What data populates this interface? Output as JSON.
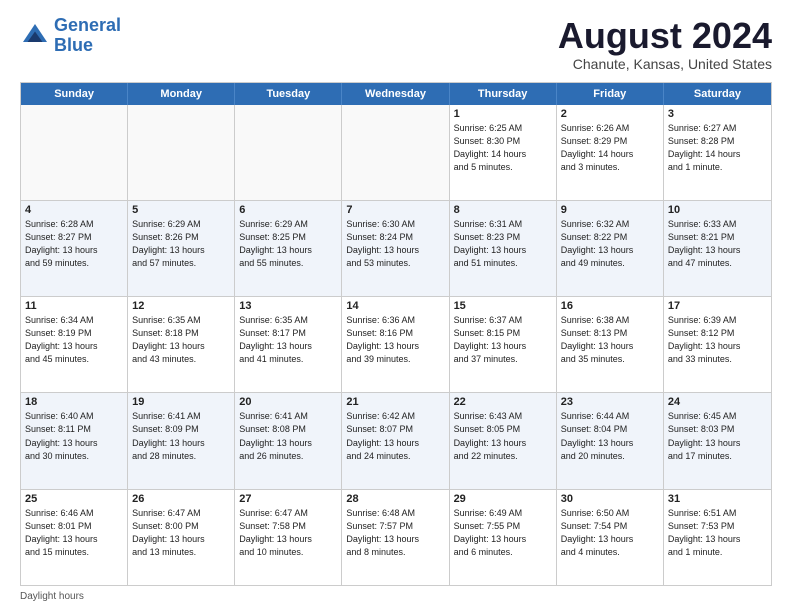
{
  "header": {
    "logo_line1": "General",
    "logo_line2": "Blue",
    "month_title": "August 2024",
    "location": "Chanute, Kansas, United States"
  },
  "weekdays": [
    "Sunday",
    "Monday",
    "Tuesday",
    "Wednesday",
    "Thursday",
    "Friday",
    "Saturday"
  ],
  "footer_note": "Daylight hours",
  "rows": [
    [
      {
        "day": "",
        "info": "",
        "empty": true
      },
      {
        "day": "",
        "info": "",
        "empty": true
      },
      {
        "day": "",
        "info": "",
        "empty": true
      },
      {
        "day": "",
        "info": "",
        "empty": true
      },
      {
        "day": "1",
        "info": "Sunrise: 6:25 AM\nSunset: 8:30 PM\nDaylight: 14 hours\nand 5 minutes.",
        "empty": false
      },
      {
        "day": "2",
        "info": "Sunrise: 6:26 AM\nSunset: 8:29 PM\nDaylight: 14 hours\nand 3 minutes.",
        "empty": false
      },
      {
        "day": "3",
        "info": "Sunrise: 6:27 AM\nSunset: 8:28 PM\nDaylight: 14 hours\nand 1 minute.",
        "empty": false
      }
    ],
    [
      {
        "day": "4",
        "info": "Sunrise: 6:28 AM\nSunset: 8:27 PM\nDaylight: 13 hours\nand 59 minutes.",
        "empty": false
      },
      {
        "day": "5",
        "info": "Sunrise: 6:29 AM\nSunset: 8:26 PM\nDaylight: 13 hours\nand 57 minutes.",
        "empty": false
      },
      {
        "day": "6",
        "info": "Sunrise: 6:29 AM\nSunset: 8:25 PM\nDaylight: 13 hours\nand 55 minutes.",
        "empty": false
      },
      {
        "day": "7",
        "info": "Sunrise: 6:30 AM\nSunset: 8:24 PM\nDaylight: 13 hours\nand 53 minutes.",
        "empty": false
      },
      {
        "day": "8",
        "info": "Sunrise: 6:31 AM\nSunset: 8:23 PM\nDaylight: 13 hours\nand 51 minutes.",
        "empty": false
      },
      {
        "day": "9",
        "info": "Sunrise: 6:32 AM\nSunset: 8:22 PM\nDaylight: 13 hours\nand 49 minutes.",
        "empty": false
      },
      {
        "day": "10",
        "info": "Sunrise: 6:33 AM\nSunset: 8:21 PM\nDaylight: 13 hours\nand 47 minutes.",
        "empty": false
      }
    ],
    [
      {
        "day": "11",
        "info": "Sunrise: 6:34 AM\nSunset: 8:19 PM\nDaylight: 13 hours\nand 45 minutes.",
        "empty": false
      },
      {
        "day": "12",
        "info": "Sunrise: 6:35 AM\nSunset: 8:18 PM\nDaylight: 13 hours\nand 43 minutes.",
        "empty": false
      },
      {
        "day": "13",
        "info": "Sunrise: 6:35 AM\nSunset: 8:17 PM\nDaylight: 13 hours\nand 41 minutes.",
        "empty": false
      },
      {
        "day": "14",
        "info": "Sunrise: 6:36 AM\nSunset: 8:16 PM\nDaylight: 13 hours\nand 39 minutes.",
        "empty": false
      },
      {
        "day": "15",
        "info": "Sunrise: 6:37 AM\nSunset: 8:15 PM\nDaylight: 13 hours\nand 37 minutes.",
        "empty": false
      },
      {
        "day": "16",
        "info": "Sunrise: 6:38 AM\nSunset: 8:13 PM\nDaylight: 13 hours\nand 35 minutes.",
        "empty": false
      },
      {
        "day": "17",
        "info": "Sunrise: 6:39 AM\nSunset: 8:12 PM\nDaylight: 13 hours\nand 33 minutes.",
        "empty": false
      }
    ],
    [
      {
        "day": "18",
        "info": "Sunrise: 6:40 AM\nSunset: 8:11 PM\nDaylight: 13 hours\nand 30 minutes.",
        "empty": false
      },
      {
        "day": "19",
        "info": "Sunrise: 6:41 AM\nSunset: 8:09 PM\nDaylight: 13 hours\nand 28 minutes.",
        "empty": false
      },
      {
        "day": "20",
        "info": "Sunrise: 6:41 AM\nSunset: 8:08 PM\nDaylight: 13 hours\nand 26 minutes.",
        "empty": false
      },
      {
        "day": "21",
        "info": "Sunrise: 6:42 AM\nSunset: 8:07 PM\nDaylight: 13 hours\nand 24 minutes.",
        "empty": false
      },
      {
        "day": "22",
        "info": "Sunrise: 6:43 AM\nSunset: 8:05 PM\nDaylight: 13 hours\nand 22 minutes.",
        "empty": false
      },
      {
        "day": "23",
        "info": "Sunrise: 6:44 AM\nSunset: 8:04 PM\nDaylight: 13 hours\nand 20 minutes.",
        "empty": false
      },
      {
        "day": "24",
        "info": "Sunrise: 6:45 AM\nSunset: 8:03 PM\nDaylight: 13 hours\nand 17 minutes.",
        "empty": false
      }
    ],
    [
      {
        "day": "25",
        "info": "Sunrise: 6:46 AM\nSunset: 8:01 PM\nDaylight: 13 hours\nand 15 minutes.",
        "empty": false
      },
      {
        "day": "26",
        "info": "Sunrise: 6:47 AM\nSunset: 8:00 PM\nDaylight: 13 hours\nand 13 minutes.",
        "empty": false
      },
      {
        "day": "27",
        "info": "Sunrise: 6:47 AM\nSunset: 7:58 PM\nDaylight: 13 hours\nand 10 minutes.",
        "empty": false
      },
      {
        "day": "28",
        "info": "Sunrise: 6:48 AM\nSunset: 7:57 PM\nDaylight: 13 hours\nand 8 minutes.",
        "empty": false
      },
      {
        "day": "29",
        "info": "Sunrise: 6:49 AM\nSunset: 7:55 PM\nDaylight: 13 hours\nand 6 minutes.",
        "empty": false
      },
      {
        "day": "30",
        "info": "Sunrise: 6:50 AM\nSunset: 7:54 PM\nDaylight: 13 hours\nand 4 minutes.",
        "empty": false
      },
      {
        "day": "31",
        "info": "Sunrise: 6:51 AM\nSunset: 7:53 PM\nDaylight: 13 hours\nand 1 minute.",
        "empty": false
      }
    ]
  ]
}
